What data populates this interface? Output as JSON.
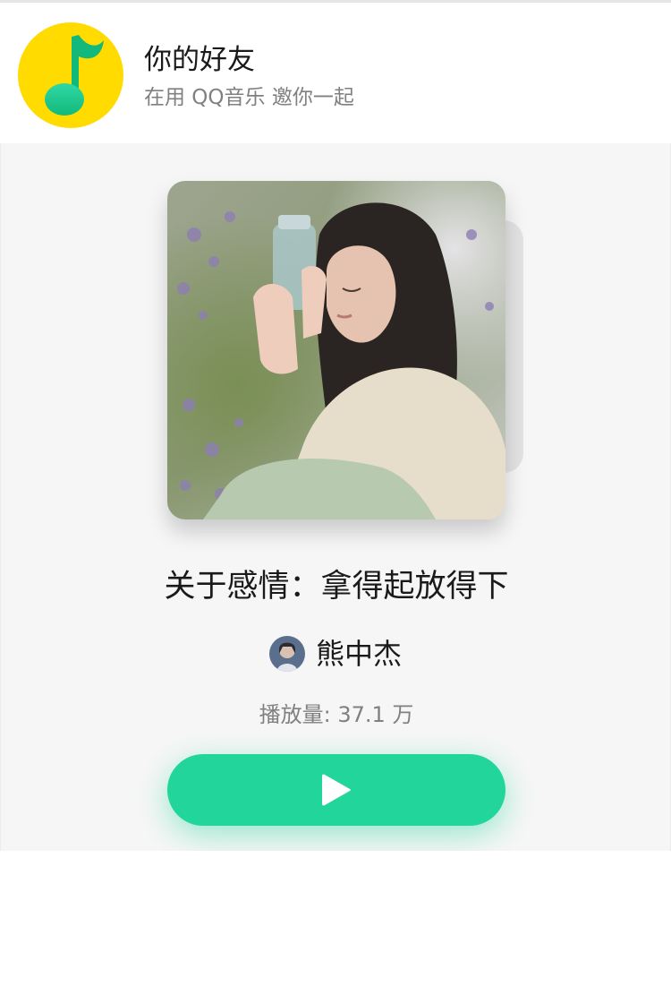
{
  "header": {
    "title": "你的好友",
    "subtitle": "在用 QQ音乐 邀你一起"
  },
  "playlist": {
    "title": "关于感情：拿得起放得下",
    "creator_name": "熊中杰",
    "play_count": "播放量: 37.1 万"
  },
  "icons": {
    "app_logo": "qq-music-logo",
    "play": "play-icon"
  },
  "colors": {
    "brand_yellow": "#ffdb00",
    "brand_green": "#21d59b",
    "background": "#f6f6f6"
  }
}
